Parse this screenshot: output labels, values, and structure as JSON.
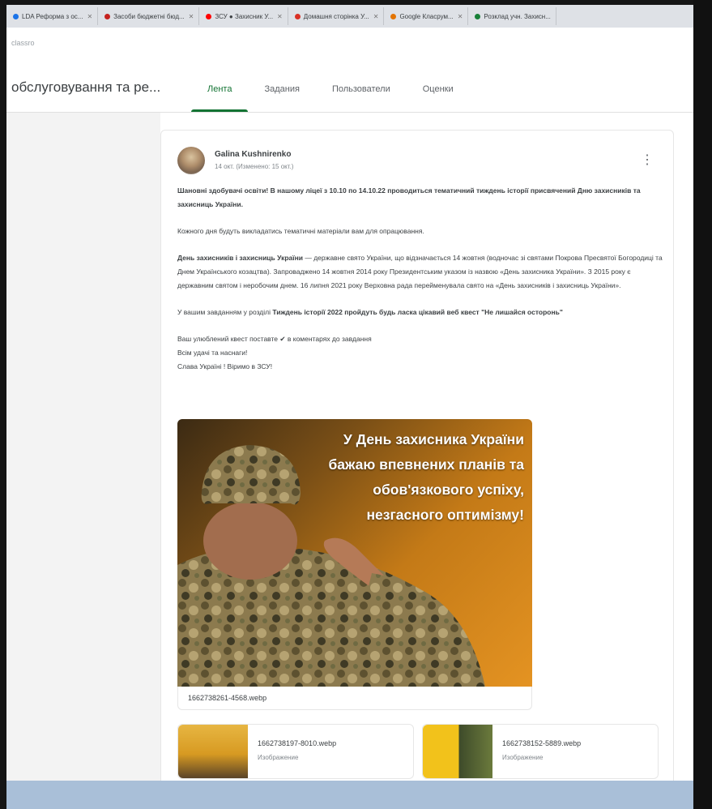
{
  "browser": {
    "tabs": [
      {
        "label": "LDA Реформа з ос...",
        "color": "#1a73e8"
      },
      {
        "label": "Засоби бюджетні бюд...",
        "color": "#c5221f"
      },
      {
        "label": "ЗСУ ● Захисник У...",
        "color": "#ff0000"
      },
      {
        "label": "Домашня сторінка У...",
        "color": "#d93025"
      },
      {
        "label": "Google Класрум...",
        "color": "#e37400"
      },
      {
        "label": "Розклад учн. Захисн...",
        "color": "#188038"
      }
    ],
    "address_text": "classro"
  },
  "classroom": {
    "title": "обслуговування та ре...",
    "tabs": [
      "Лента",
      "Задания",
      "Пользователи",
      "Оценки"
    ],
    "active_tab": "Лента",
    "accent": "#137333"
  },
  "post": {
    "author": "Galina Kushnirenko",
    "meta": "14 окт. (Изменено: 15 окт.)",
    "paragraphs": [
      {
        "bold": "Шановні здобувачі освіти! В нашому ліцеї з 10.10 по 14.10.22 проводиться тематичний тиждень історії присвячений Дню захисників та захисниць України.",
        "text": ""
      },
      {
        "bold": "",
        "text": "Кожного дня будуть викладатись тематичні матеріали вам для опрацювання."
      },
      {
        "bold": "День захисників і захисниць України",
        "text": " — державне свято України, що відзначається 14 жовтня (водночас зі святами Покрова Пресвятої Богородиці та Днем Українського козацтва). Запроваджено 14 жовтня 2014 року Президентським указом із назвою «День захисника України». З 2015 року є державним святом і неробочим днем. 16 липня 2021 року Верховна рада перейменувала свято на «День захисників і захисниць України»."
      },
      {
        "bold": "Тиждень історії 2022 пройдуть будь ласка цікавий веб квест \"Не лишайся осторонь\"",
        "text": "У вашим завданням у розділі "
      },
      {
        "bold": "",
        "text": "Ваш улюблений квест поставте ✔ в коментарях до завдання\nВсім удачі та наснаги!\nСлава Україні ! Віримо в ЗСУ!"
      }
    ],
    "image_text": [
      "У День захисника України",
      "бажаю впевнених планів та",
      "обов'язкового успіху,",
      "незгасного оптимізму!"
    ],
    "image_filename": "1662738261-4568.webp",
    "attachments": [
      {
        "name": "1662738197-8010.webp",
        "type": "Изображение"
      },
      {
        "name": "1662738152-5889.webp",
        "type": "Изображение"
      }
    ]
  }
}
